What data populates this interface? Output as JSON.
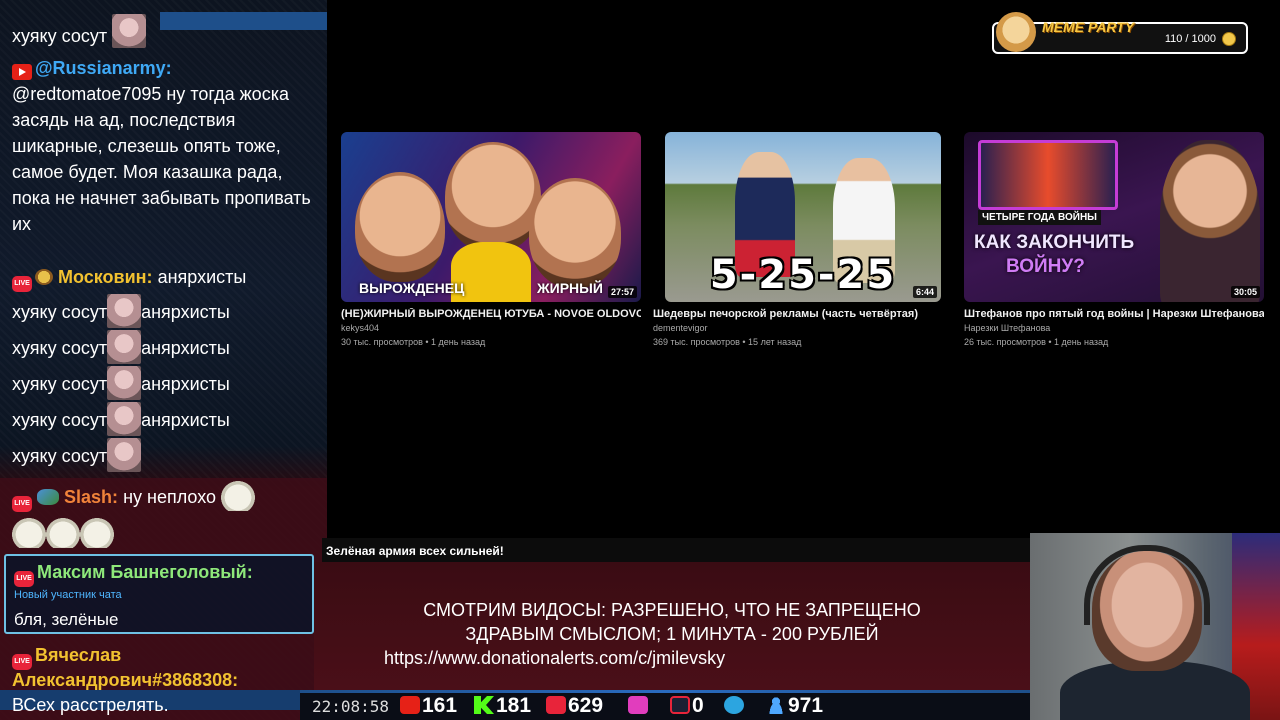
{
  "chat": {
    "top_fragment": "хуяку сосут",
    "msg_russianarmy": {
      "nick": "@Russianarmy:",
      "text": "@redtomatoe7095 ну тогда жоска засядь на ад, последствия шикарные, слезешь опять тоже, самое будет. Моя казашка рада, пока не начнет забывать пропивать их"
    },
    "msg_moskovin": {
      "nick": "Московин:",
      "first_text": "анярхисты",
      "lines": [
        "хуяку сосут",
        "анярхисты",
        "хуяку сосут",
        "анярхисты",
        "хуяку сосут",
        "анярхисты",
        "хуяку сосут",
        "анярхисты",
        "хуяку сосут"
      ]
    },
    "msg_slash": {
      "nick": "Slash:",
      "text": "ну неплохо"
    },
    "msg_highlight": {
      "nick": "Максим Башнеголовый:",
      "badge": "Новый участник чата",
      "text": "бля, зелёные"
    },
    "msg_vyacheslav": {
      "nick_line1": "Вячеслав",
      "nick_line2": "Александрович#3868308:",
      "text": "ВСех расстрелять."
    }
  },
  "meme_party": {
    "title": "MEME PARTY",
    "count": "110 / 1000"
  },
  "videos": [
    {
      "title": "(НЕ)ЖИРНЫЙ ВЫРОЖДЕНЕЦ ЮТУБА - NOVOE OLDOVOE",
      "channel": "kekys404",
      "meta": "30 тыс. просмотров • 1 день назад",
      "duration": "27:57",
      "thumb_text_left": "ВЫРОЖДЕНЕЦ",
      "thumb_text_right": "ЖИРНЫЙ"
    },
    {
      "title": "Шедевры печорской рекламы (часть четвёртая)",
      "channel": "dementevigor",
      "meta": "369 тыс. просмотров • 15 лет назад",
      "duration": "6:44",
      "thumb_text": "5-25-25"
    },
    {
      "title": "Штефанов про пятый год войны | Нарезки Штефанова",
      "channel": "Нарезки Штефанова",
      "meta": "26 тыс. просмотров • 1 день назад",
      "duration": "30:05",
      "thumb_banner": "ЧЕТЫРЕ ГОДА ВОЙНЫ",
      "thumb_big1": "КАК ЗАКОНЧИТЬ",
      "thumb_big2": "ВОЙНУ?"
    }
  ],
  "ticker": "Зелёная армия всех сильней!",
  "banner": {
    "line1": "СМОТРИМ ВИДОСЫ: РАЗРЕШЕНО, ЧТО НЕ ЗАПРЕЩЕНО",
    "line2": "ЗДРАВЫМ СМЫСЛОМ; 1 МИНУТА - 200 РУБЛЕЙ",
    "link": "https://www.donationalerts.com/c/jmilevsky"
  },
  "stats": {
    "time": "22:08:58",
    "youtube": "161",
    "kick": "181",
    "live": "629",
    "vkplay": "",
    "rutube": "0",
    "total": "971"
  },
  "colors": {
    "nick_blue": "#3fa9f5",
    "nick_yellow": "#f2c230",
    "nick_orange": "#f0833a",
    "nick_green": "#8ee87a",
    "nick_gold": "#f2c230"
  }
}
